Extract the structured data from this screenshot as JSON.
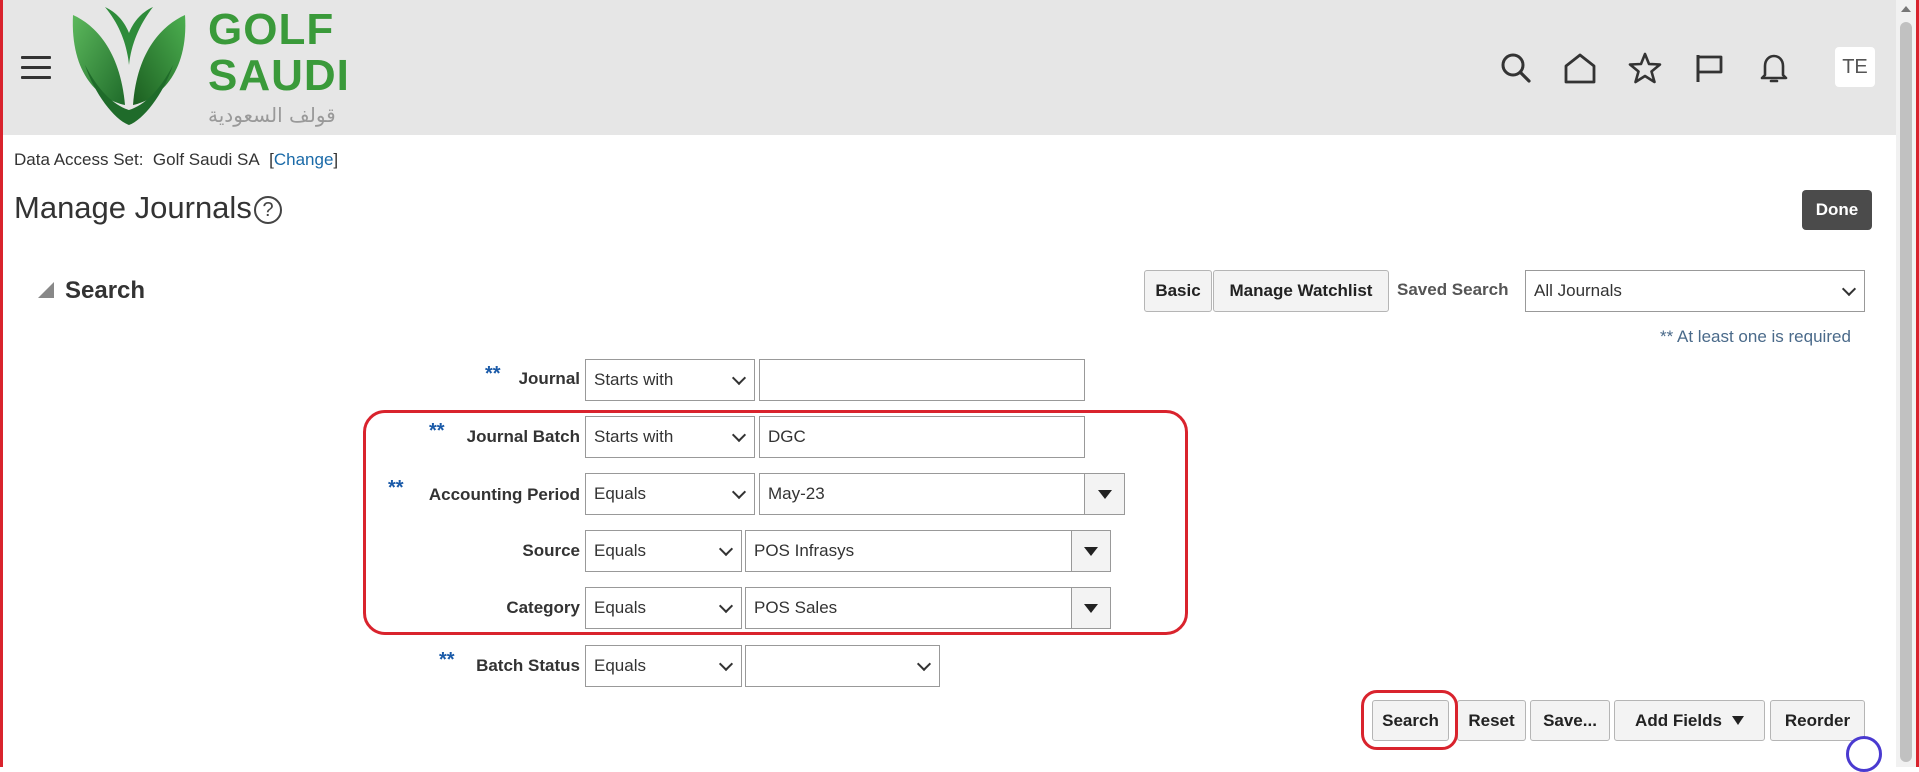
{
  "header": {
    "logo_text_line1": "GOLF",
    "logo_text_line2": "SAUDI",
    "logo_arabic": "قولف السعودية",
    "user_initials": "TE",
    "colors": {
      "brand_green": "#3a9a3a",
      "header_bg": "#e6e6e6"
    },
    "icons": [
      "menu-icon",
      "search-icon",
      "home-icon",
      "favorites-star-icon",
      "flag-icon",
      "notifications-bell-icon"
    ]
  },
  "data_access": {
    "label": "Data Access Set:",
    "value": "Golf Saudi SA",
    "change_link": "Change"
  },
  "page": {
    "title": "Manage Journals",
    "done_label": "Done"
  },
  "search": {
    "heading": "Search",
    "basic_label": "Basic",
    "manage_watchlist_label": "Manage Watchlist",
    "saved_search_label": "Saved Search",
    "saved_search_value": "All Journals",
    "required_note": "** At least one is required",
    "required_marker": "**",
    "fields": {
      "journal": {
        "label": "Journal",
        "operator": "Starts with",
        "value": ""
      },
      "journal_batch": {
        "label": "Journal Batch",
        "operator": "Starts with",
        "value": "DGC"
      },
      "accounting_period": {
        "label": "Accounting Period",
        "operator": "Equals",
        "value": "May-23"
      },
      "source": {
        "label": "Source",
        "operator": "Equals",
        "value": "POS Infrasys"
      },
      "category": {
        "label": "Category",
        "operator": "Equals",
        "value": "POS Sales"
      },
      "batch_status": {
        "label": "Batch Status",
        "operator": "Equals",
        "value": ""
      }
    },
    "buttons": {
      "search": "Search",
      "reset": "Reset",
      "save": "Save...",
      "add_fields": "Add Fields",
      "reorder": "Reorder"
    }
  },
  "annotations": {
    "highlight_color": "#d9232d"
  }
}
